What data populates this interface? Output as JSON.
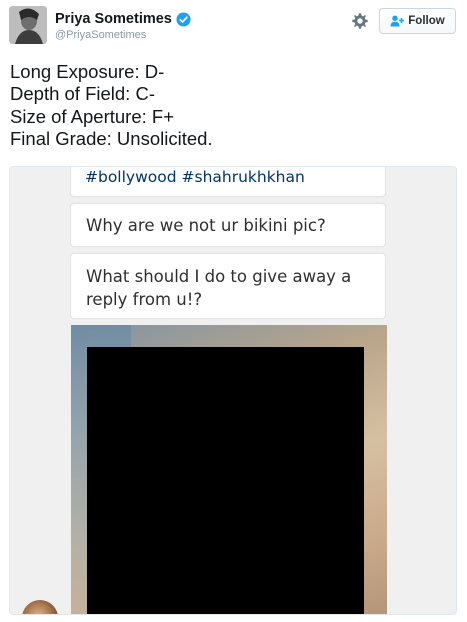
{
  "user": {
    "display_name": "Priya Sometimes",
    "handle": "@PriyaSometimes"
  },
  "actions": {
    "follow_label": "Follow"
  },
  "icons": {
    "verified": "verified-badge-icon",
    "settings": "gear-icon",
    "follow": "add-person-icon"
  },
  "colors": {
    "verified": "#1da1f2",
    "handle": "#8899a6",
    "hashtag": "#003569"
  },
  "tweet": {
    "lines": [
      "Long Exposure: D-",
      "Depth of Field: C-",
      "Size of Aperture: F+",
      "Final Grade: Unsolicited."
    ]
  },
  "media": {
    "hashtags": "#bollywood #shahrukhkhan",
    "comments": [
      "Why are we not ur bikini pic?",
      "What should I do to give away a reply from u!?"
    ]
  }
}
